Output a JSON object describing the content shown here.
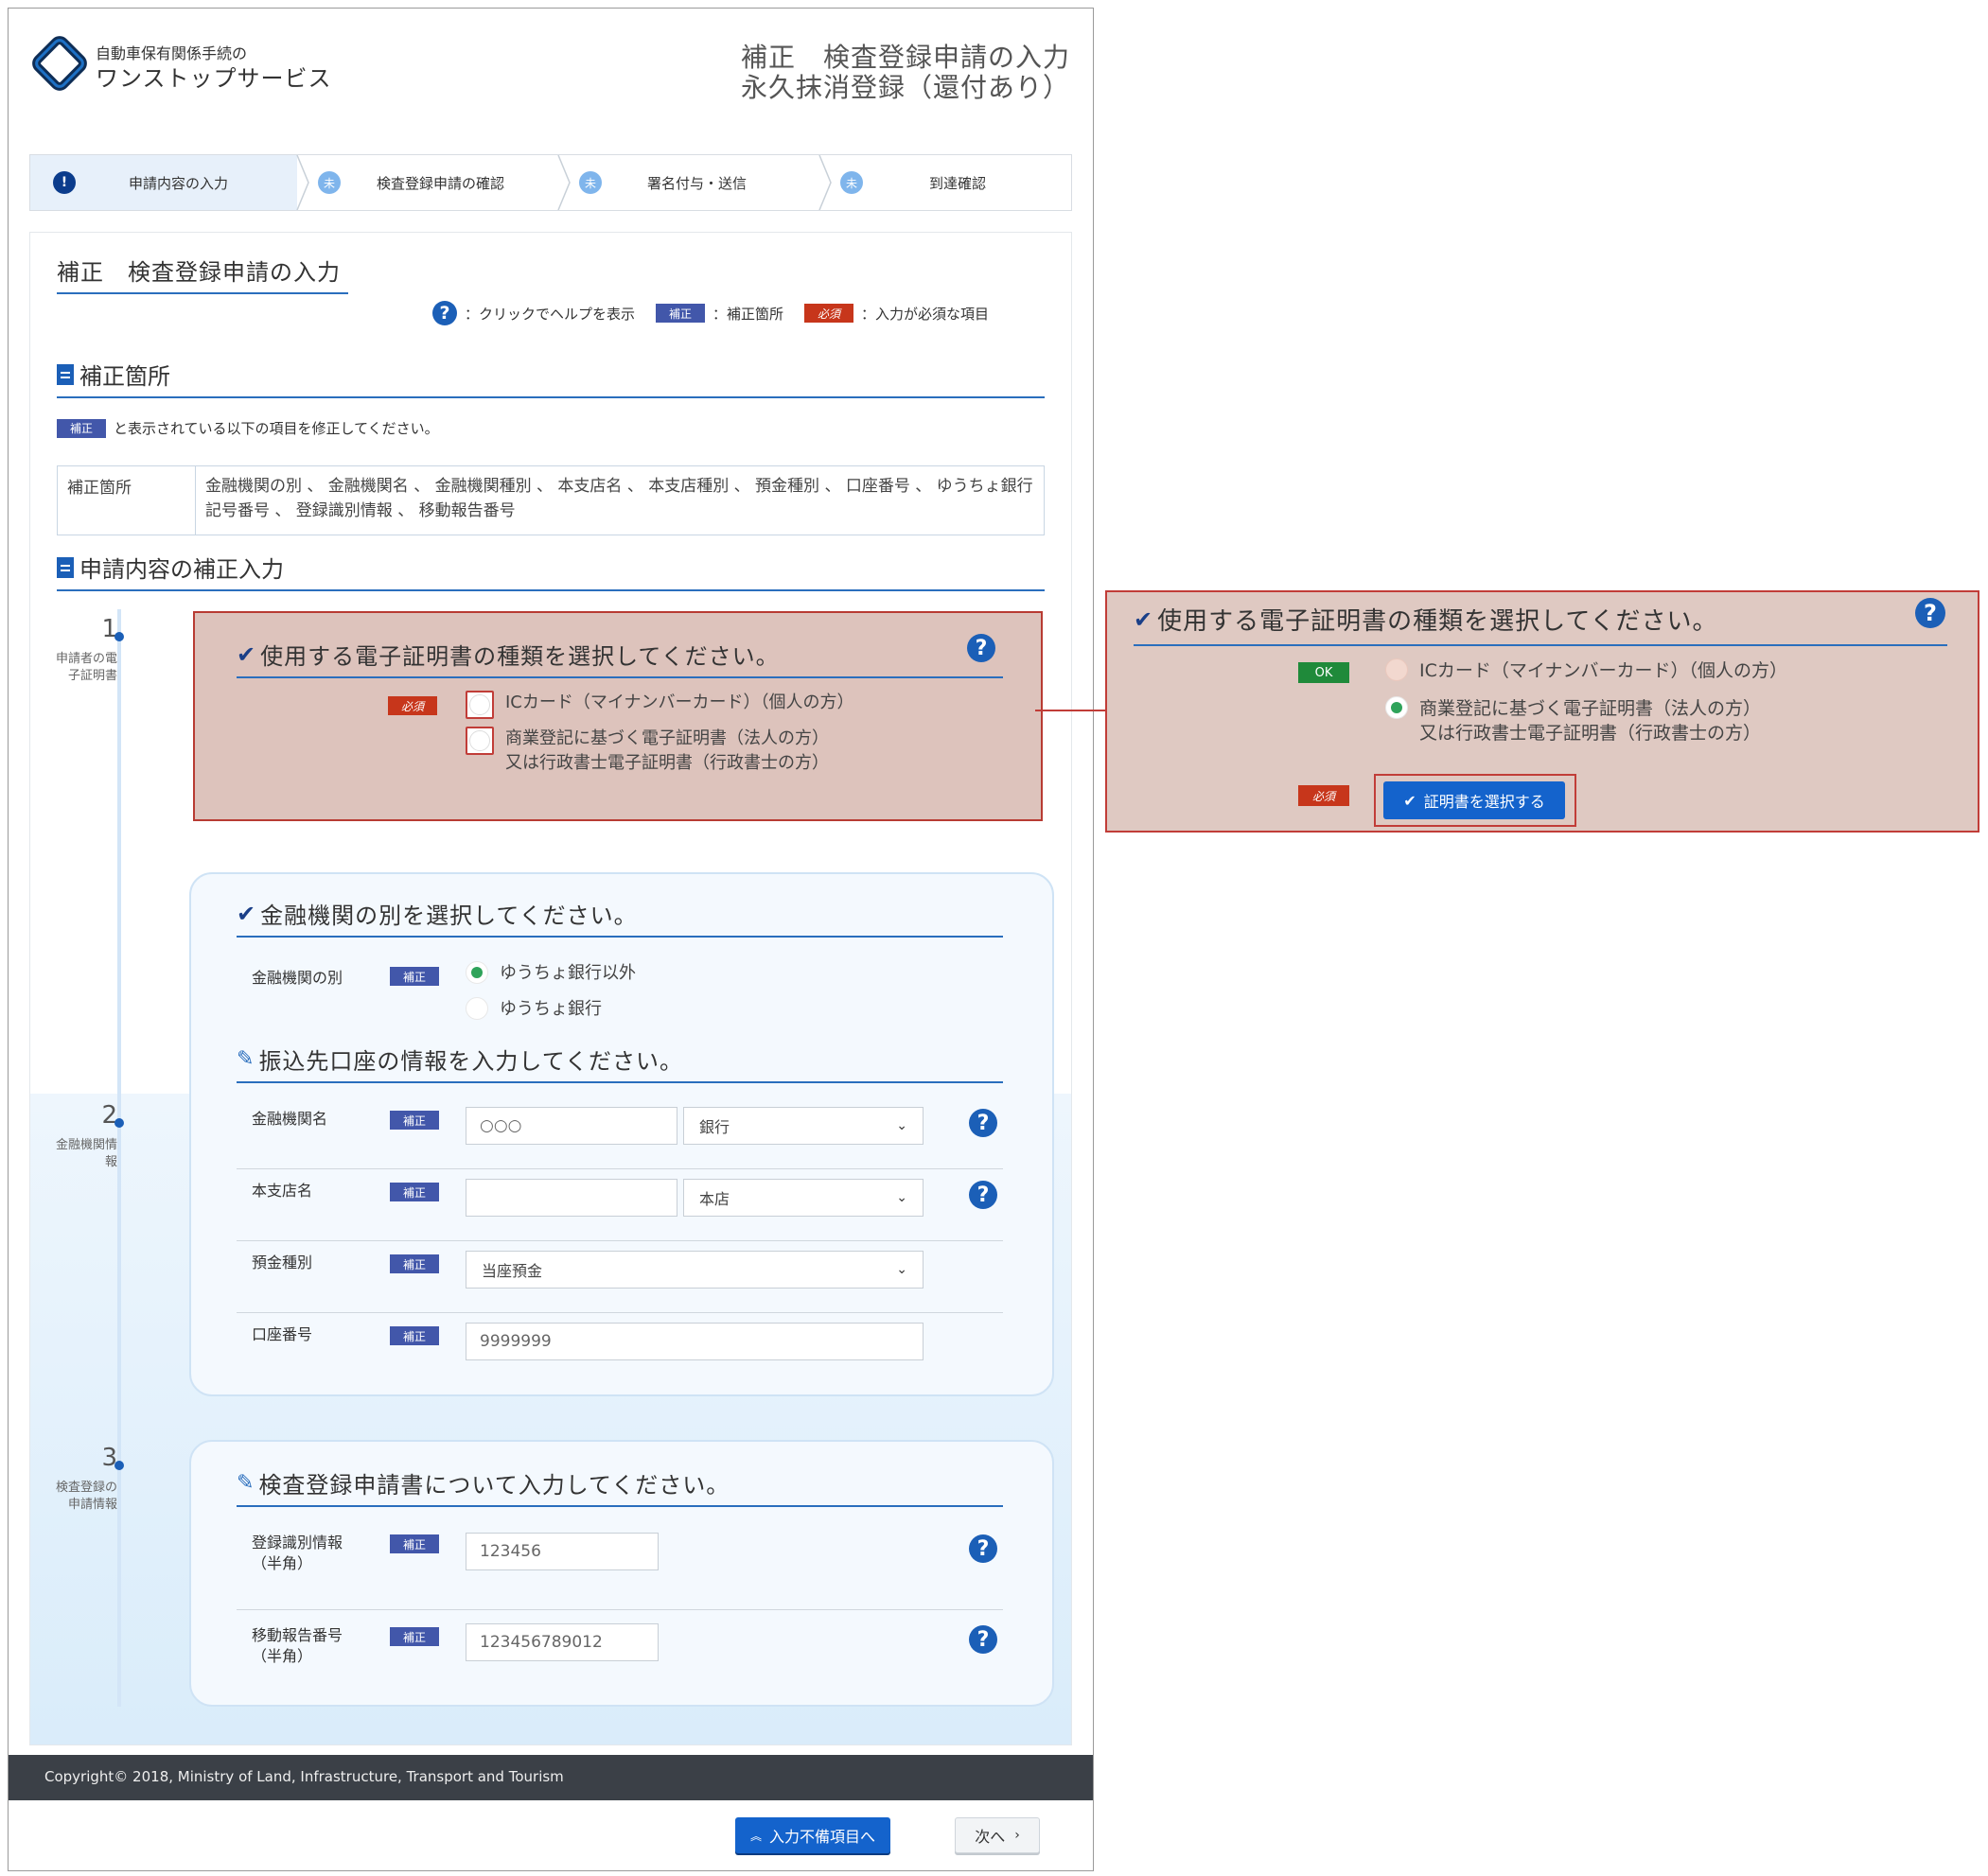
{
  "header": {
    "logo_small": "自動車保有関係手続の",
    "logo_big": "ワンストップサービス",
    "title_line1": "補正　検査登録申請の入力",
    "title_line2": "永久抹消登録（還付あり）"
  },
  "steps": [
    {
      "mark": "!",
      "label": "申請内容の入力"
    },
    {
      "mark": "未",
      "label": "検査登録申請の確認"
    },
    {
      "mark": "未",
      "label": "署名付与・送信"
    },
    {
      "mark": "未",
      "label": "到達確認"
    }
  ],
  "panel": {
    "title": "補正　検査登録申請の入力",
    "legend": {
      "help_text": "：クリックでヘルプを表示",
      "hosei_badge": "補正",
      "hosei_text": "：補正箇所",
      "required_badge": "必須",
      "required_text": "：入力が必須な項目"
    }
  },
  "section_hosei": {
    "heading": "補正箇所",
    "badge": "補正",
    "note": "と表示されている以下の項目を修正してください。",
    "table_header": "補正箇所",
    "table_value": "金融機関の別 、 金融機関名 、 金融機関種別 、 本支店名 、 本支店種別 、 預金種別 、 口座番号 、 ゆうちょ銀行記号番号 、 登録識別情報 、 移動報告番号"
  },
  "section_input": {
    "heading": "申請内容の補正入力"
  },
  "timeline": [
    {
      "num": "1",
      "label": "申請者の電子証明書"
    },
    {
      "num": "2",
      "label": "金融機関情報"
    },
    {
      "num": "3",
      "label": "検査登録の申請情報"
    }
  ],
  "card1": {
    "heading": "使用する電子証明書の種類を選択してください。",
    "badge": "必須",
    "options": [
      {
        "line1": "ICカード（マイナンバーカード）（個人の方）",
        "line2": ""
      },
      {
        "line1": "商業登記に基づく電子証明書（法人の方）",
        "line2": "又は行政書士電子証明書（行政書士の方）"
      }
    ]
  },
  "card2": {
    "heading1": "金融機関の別を選択してください。",
    "kind_label": "金融機関の別",
    "badge": "補正",
    "kind_options": [
      "ゆうちょ銀行以外",
      "ゆうちょ銀行"
    ],
    "heading2": "振込先口座の情報を入力してください。",
    "rows": [
      {
        "label": "金融機関名",
        "value": "○○○",
        "select": "銀行"
      },
      {
        "label": "本支店名",
        "value": "",
        "select": "本店"
      },
      {
        "label": "預金種別",
        "select": "当座預金"
      },
      {
        "label": "口座番号",
        "value": "9999999"
      }
    ]
  },
  "card3": {
    "heading": "検査登録申請書について入力してください。",
    "badge": "補正",
    "rows": [
      {
        "label1": "登録識別情報",
        "label2": "（半角）",
        "value": "123456"
      },
      {
        "label1": "移動報告番号",
        "label2": "（半角）",
        "value": "123456789012"
      }
    ]
  },
  "footer": {
    "copyright": "Copyright© 2018, Ministry of Land, Infrastructure, Transport and Tourism",
    "back_button": "入力不備項目へ",
    "next_button": "次へ"
  },
  "callout": {
    "heading": "使用する電子証明書の種類を選択してください。",
    "ok_badge": "OK",
    "required_badge": "必須",
    "options": [
      {
        "line1": "ICカード（マイナンバーカード）（個人の方）",
        "line2": ""
      },
      {
        "line1": "商業登記に基づく電子証明書（法人の方）",
        "line2": "又は行政書士電子証明書（行政書士の方）"
      }
    ],
    "select_button": "証明書を選択する"
  },
  "colors": {
    "brand_blue": "#1463cc",
    "navy": "#0b3c8c",
    "hosei_badge": "#4257aa",
    "required_badge": "#c7361b",
    "ok_badge": "#1f8a3a",
    "error_border": "#c13d38"
  }
}
